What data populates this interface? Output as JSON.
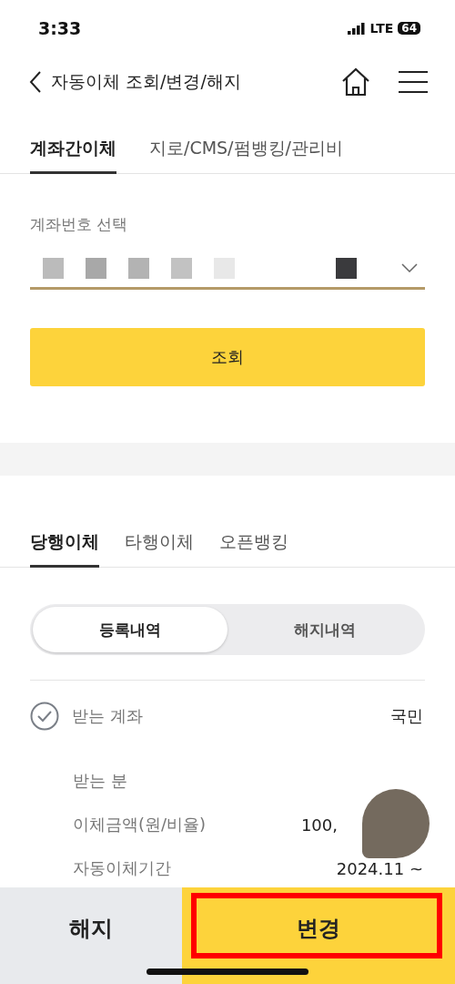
{
  "status_bar": {
    "time": "3:33",
    "network": "LTE",
    "battery": "64"
  },
  "header": {
    "title": "자동이체 조회/변경/해지"
  },
  "tabs": [
    {
      "label": "계좌간이체",
      "selected": true
    },
    {
      "label": "지로/CMS/펌뱅킹/관리비",
      "selected": false
    }
  ],
  "account_select": {
    "label": "계좌번호 선택"
  },
  "search_button": "조회",
  "sub_tabs": [
    {
      "label": "당행이체",
      "selected": true
    },
    {
      "label": "타행이체",
      "selected": false
    },
    {
      "label": "오픈뱅킹",
      "selected": false
    }
  ],
  "segments": [
    {
      "label": "등록내역",
      "selected": true
    },
    {
      "label": "해지내역",
      "selected": false
    }
  ],
  "record": {
    "checked": true,
    "title": "받는 계좌",
    "bank": "국민",
    "details": [
      {
        "label": "받는 분"
      },
      {
        "label": "이체금액(원/비율)",
        "value": "100,"
      },
      {
        "label": "자동이체기간",
        "value": "2024.11 ~"
      }
    ]
  },
  "actions": [
    {
      "label": "해지",
      "kind": "secondary",
      "highlighted": false
    },
    {
      "label": "변경",
      "kind": "primary",
      "highlighted": true
    }
  ]
}
